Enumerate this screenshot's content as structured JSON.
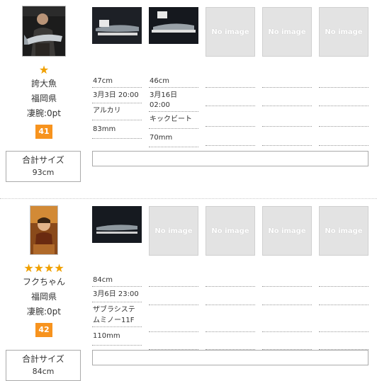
{
  "entries": [
    {
      "name": "誇大魚",
      "prefecture": "福岡県",
      "skill": "凄腕:0pt",
      "rank": "41",
      "stars": "★",
      "total_label": "合計サイズ",
      "total_value": "93cm",
      "no_image_label": "No image",
      "catches": [
        {
          "size": "47cm",
          "date": "3月3日 20:00",
          "lure": "アルカリ",
          "lure_size": "83mm"
        },
        {
          "size": "46cm",
          "date_line1": "3月16日",
          "date_line2": "02:00",
          "lure": "キックビート",
          "lure_size": "70mm"
        }
      ]
    },
    {
      "name": "フクちゃん",
      "prefecture": "福岡県",
      "skill": "凄腕:0pt",
      "rank": "42",
      "stars": "★★★★",
      "total_label": "合計サイズ",
      "total_value": "84cm",
      "no_image_label": "No image",
      "catches": [
        {
          "size": "84cm",
          "date": "3月6日 23:00",
          "lure_line1": "ザブラシステ",
          "lure_line2": "ムミノー11F",
          "lure_size": "110mm"
        }
      ]
    }
  ],
  "colors": {
    "rank_badge": "#f7931e",
    "stars": "#f0a000",
    "no_image_bg": "#e3e3e3"
  },
  "icons": {
    "rank": "star-icon"
  }
}
